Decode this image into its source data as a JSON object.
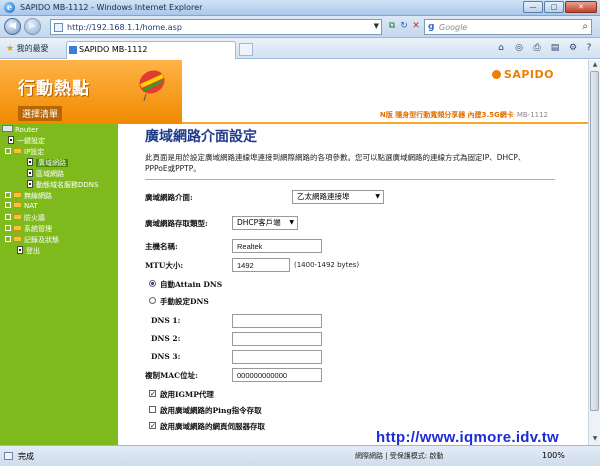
{
  "window": {
    "title": "SAPIDO MB-1112 - Windows Internet Explorer",
    "btn_min": "—",
    "btn_max": "□",
    "btn_close": "✕"
  },
  "address": {
    "url": "http://192.168.1.1/home.asp",
    "search_placeholder": "Google"
  },
  "tabs": {
    "favorites_label": "我的最愛",
    "active_tab": "SAPIDO MB-1112"
  },
  "header": {
    "brand": "行動熱點",
    "menu_label": "選擇清單",
    "logo": "SAPIDO",
    "subtitle": "N版 隨身型行動寬頻分享器 內建3.5G網卡",
    "model": "MB-1112"
  },
  "sidebar": {
    "items": [
      {
        "label": "Router",
        "type": "router"
      },
      {
        "label": "一鍵設定",
        "type": "doc"
      },
      {
        "label": "IP設定",
        "type": "folder"
      },
      {
        "label": "廣域網路",
        "type": "doc",
        "selected": true
      },
      {
        "label": "區域網路",
        "type": "doc"
      },
      {
        "label": "動態域名服務DDNS",
        "type": "doc"
      },
      {
        "label": "無線網路",
        "type": "folder"
      },
      {
        "label": "NAT",
        "type": "folder"
      },
      {
        "label": "防火牆",
        "type": "folder"
      },
      {
        "label": "系統管理",
        "type": "folder"
      },
      {
        "label": "記錄及狀態",
        "type": "folder"
      },
      {
        "label": "登出",
        "type": "doc"
      }
    ]
  },
  "main": {
    "title": "廣域網路介面設定",
    "description": "此頁面是用於設定廣域網路連線埠連接到網際網路的各項參數。您可以點選廣域網路的連線方式為固定IP、DHCP、PPPoE或PPTP。",
    "wan_interface_label": "廣域網路介面:",
    "wan_interface_value": "乙太網路連接埠",
    "wan_access_label": "廣域網路存取類型:",
    "wan_access_value": "DHCP客戶端",
    "host_name_label": "主機名稱:",
    "host_name_value": "Realtek",
    "mtu_label": "MTU大小:",
    "mtu_value": "1492",
    "mtu_hint": "(1400-1492 bytes)",
    "dns_auto_label": "自動Attain DNS",
    "dns_manual_label": "手動設定DNS",
    "dns1_label": "DNS 1:",
    "dns2_label": "DNS 2:",
    "dns3_label": "DNS 3:",
    "clone_mac_label": "複制MAC位址:",
    "clone_mac_value": "000000000000",
    "igmp_label": "啟用IGMP代理",
    "ping_label": "啟用廣域網路的Ping指令存取",
    "web_label": "啟用廣域網路的網頁伺服器存取"
  },
  "watermark": "http://www.iqmore.idv.tw",
  "status": {
    "done": "完成",
    "zone": "網際網路 | 受保護模式: 啟動",
    "zoom": "100%"
  },
  "colors": {
    "sidebar": "#7fba1d",
    "header_orange": "#f08a00",
    "title_blue": "#1f3b8a"
  }
}
